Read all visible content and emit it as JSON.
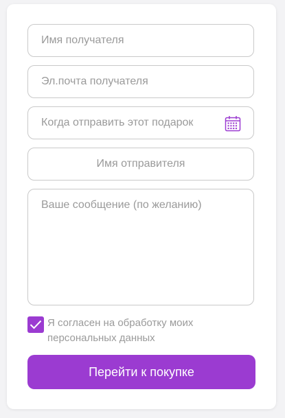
{
  "form": {
    "recipient_name_placeholder": "Имя получателя",
    "recipient_email_placeholder": "Эл.почта получателя",
    "send_date_placeholder": "Когда отправить этот подарок",
    "sender_name_placeholder": "Имя отправителя",
    "message_placeholder": "Ваше сообщение (по желанию)",
    "consent_label": "Я согласен на обработку моих персональных данных",
    "consent_checked": true,
    "submit_label": "Перейти к покупке",
    "icons": {
      "date_picker": "calendar-icon",
      "checkbox_mark": "checkmark-icon"
    }
  },
  "colors": {
    "accent": "#9b3bd1",
    "placeholder_text": "#9a9a9a",
    "field_border": "#c9c9c9",
    "background": "#f3f3f5"
  }
}
